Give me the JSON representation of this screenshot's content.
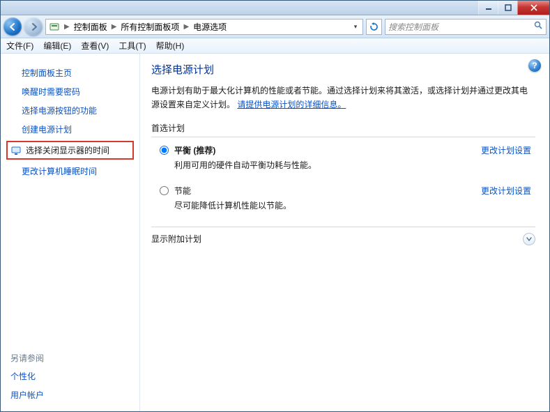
{
  "titlebar": {},
  "breadcrumb": {
    "root": "控制面板",
    "mid": "所有控制面板项",
    "leaf": "电源选项"
  },
  "search": {
    "placeholder": "搜索控制面板"
  },
  "menubar": {
    "file": "文件(F)",
    "edit": "编辑(E)",
    "view": "查看(V)",
    "tools": "工具(T)",
    "help": "帮助(H)"
  },
  "sidebar": {
    "home": "控制面板主页",
    "links": [
      "唤醒时需要密码",
      "选择电源按钮的功能",
      "创建电源计划"
    ],
    "highlighted": "选择关闭显示器的时间",
    "after_hl": [
      "更改计算机睡眠时间"
    ],
    "see_also_label": "另请参阅",
    "see_also": [
      "个性化",
      "用户帐户"
    ]
  },
  "content": {
    "heading": "选择电源计划",
    "desc_prefix": "电源计划有助于最大化计算机的性能或者节能。通过选择计划来将其激活，或选择计划并通过更改其电源设置来自定义计划。",
    "desc_link": "请提供电源计划的详细信息。",
    "preferred_label": "首选计划",
    "plans": [
      {
        "title": "平衡 (推荐)",
        "sub": "利用可用的硬件自动平衡功耗与性能。",
        "link": "更改计划设置",
        "checked": true
      },
      {
        "title": "节能",
        "sub": "尽可能降低计算机性能以节能。",
        "link": "更改计划设置",
        "checked": false
      }
    ],
    "show_more": "显示附加计划"
  }
}
